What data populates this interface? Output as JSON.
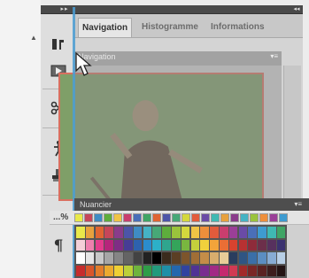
{
  "tabs": [
    {
      "label": "Navigation",
      "active": true
    },
    {
      "label": "Histogramme",
      "active": false
    },
    {
      "label": "Informations",
      "active": false
    }
  ],
  "floating_panel": {
    "title": "Navigation"
  },
  "lower_panel": {
    "tab_label": "Nuancier",
    "header_text": "...%"
  },
  "icons": [
    "tools-icon",
    "play-icon",
    "scissors-icon",
    "puppet-icon",
    "stamp-icon",
    "paragraph-icon"
  ],
  "colors": {
    "guide": "#4b9ed4",
    "preview_bg": "#7e9f66",
    "preview_border": "#d96f5f",
    "dock_dark": "#4a4a4a"
  },
  "swatch_rows": [
    [
      "#e9e94a",
      "#e7a13e",
      "#e06433",
      "#c6465a",
      "#8a3c8b",
      "#4c55a8",
      "#3f8cc4",
      "#45b3c4",
      "#47a877",
      "#5ead3c",
      "#9ac33c",
      "#d4d83d",
      "#f0c445",
      "#ee8f3b",
      "#e25b3c",
      "#c93e6e",
      "#9b3f97",
      "#6a4ba6",
      "#4a6fb8",
      "#3e9bd0",
      "#3fb9b2",
      "#40a565"
    ],
    [
      "#f4d0d8",
      "#ee7fae",
      "#e33c8d",
      "#b6257b",
      "#7f2d85",
      "#473d95",
      "#2d62ae",
      "#2b8ccd",
      "#2cb0c8",
      "#2fa58e",
      "#34a45a",
      "#79b73f",
      "#c4cf3c",
      "#f1d13c",
      "#f3a43a",
      "#ea6e35",
      "#d8432f",
      "#b83132",
      "#8e2b3a",
      "#6c2f4a",
      "#57315e",
      "#3b3270"
    ],
    [
      "#ffffff",
      "#e6e6e6",
      "#c8c8c8",
      "#a6a6a6",
      "#858585",
      "#646464",
      "#434343",
      "#222222",
      "#000000",
      "#3a2b1d",
      "#5b3f24",
      "#7d552c",
      "#a06e36",
      "#c48d48",
      "#d9ad6d",
      "#e8cc98",
      "#2a3d5e",
      "#2f5583",
      "#3a6fa8",
      "#5b8ec2",
      "#87acd4",
      "#b8cfe6"
    ],
    [
      "#c62c2c",
      "#d8562b",
      "#e27d2b",
      "#ebaa2f",
      "#efd034",
      "#bcd03a",
      "#6fb43d",
      "#2f9d48",
      "#239a7c",
      "#1f8fa7",
      "#2467ad",
      "#3143a0",
      "#503395",
      "#792d8f",
      "#a22a85",
      "#c52a6f",
      "#d13a53",
      "#a32a2a",
      "#7a2626",
      "#5b2222",
      "#3d1e1e",
      "#241414"
    ]
  ]
}
